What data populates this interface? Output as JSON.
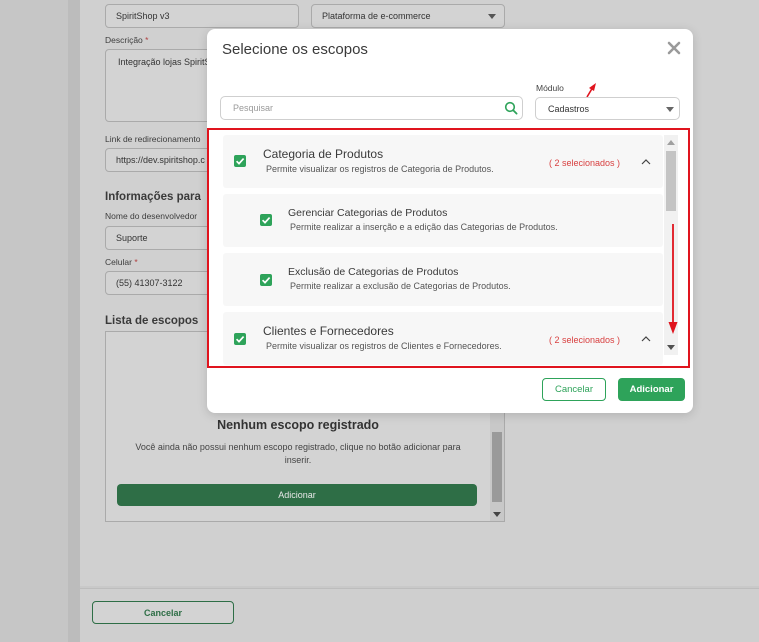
{
  "background": {
    "app_name_value": "SpiritShop v3",
    "platform_value": "Plataforma de e-commerce",
    "description_label": "Descrição",
    "required_mark": "*",
    "description_value": "Integração lojas SpiritS",
    "redirect_label": "Link de redirecionamento",
    "redirect_value": "https://dev.spiritshop.c",
    "dev_info_title": "Informações para",
    "dev_name_label": "Nome do desenvolvedor",
    "dev_name_value": "Suporte",
    "phone_label": "Celular",
    "phone_value": "(55) 41307-3122",
    "scope_list_title": "Lista de escopos",
    "empty_title": "Nenhum escopo registrado",
    "empty_text": "Você ainda não possui nenhum escopo registrado, clique no botão adicionar para inserir.",
    "add_button_label": "Adicionar",
    "cancel_button_label": "Cancelar"
  },
  "modal": {
    "title": "Selecione os escopos",
    "search_placeholder": "Pesquisar",
    "module_label": "Módulo",
    "module_value": "Cadastros",
    "items": [
      {
        "title": "Categoria de Produtos",
        "description": "Permite visualizar os registros de Categoria de Produtos.",
        "count": "( 2 selecionados )",
        "checked": true,
        "children": [
          {
            "title": "Gerenciar Categorias de Produtos",
            "description": "Permite realizar a inserção e a edição das Categorias de Produtos.",
            "checked": true
          },
          {
            "title": "Exclusão de Categorias de Produtos",
            "description": "Permite realizar a exclusão de Categorias de Produtos.",
            "checked": true
          }
        ]
      },
      {
        "title": "Clientes e Fornecedores",
        "description": "Permite visualizar os registros de Clientes e Fornecedores.",
        "count": "( 2 selecionados )",
        "checked": true
      }
    ],
    "cancel_label": "Cancelar",
    "add_label": "Adicionar"
  },
  "colors": {
    "accent_green": "#2ea35a",
    "highlight_red": "#e0141e",
    "count_red": "#d84040"
  }
}
